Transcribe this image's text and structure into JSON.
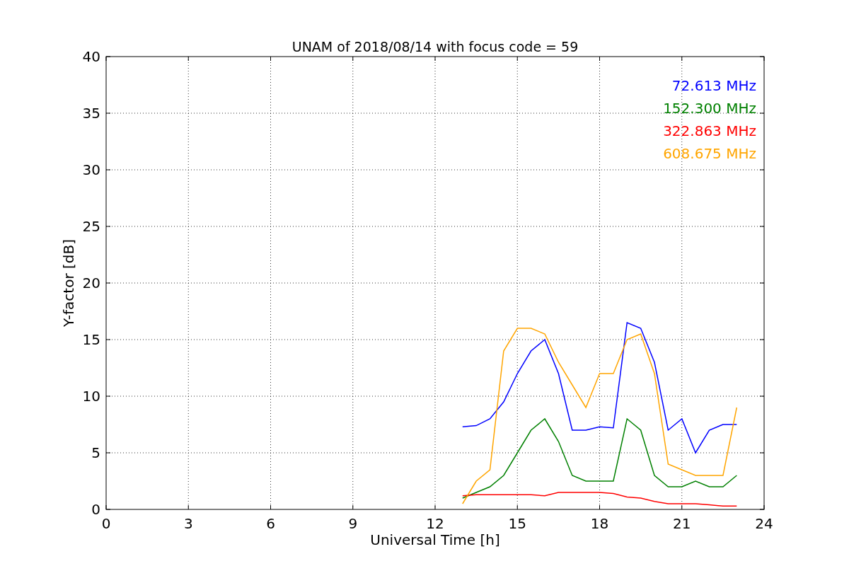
{
  "figure": {
    "chart_data": {
      "type": "line",
      "title": "UNAM of 2018/08/14 with focus code = 59",
      "xlabel": "Universal Time [h]",
      "ylabel": "Y-factor [dB]",
      "x": [
        13,
        13.5,
        14,
        14.5,
        15,
        15.5,
        16,
        16.5,
        17,
        17.5,
        18,
        18.5,
        19,
        19.5,
        20,
        20.5,
        21,
        21.5,
        22,
        22.5,
        23
      ],
      "series": [
        {
          "name": "72.613 MHz",
          "color": "#0000ff",
          "values": [
            7.3,
            7.4,
            8,
            9.5,
            12,
            14,
            15,
            12,
            7,
            7,
            7.3,
            7.2,
            16.5,
            16,
            13,
            7,
            8,
            5,
            7,
            7.5,
            7.5
          ]
        },
        {
          "name": "152.300 MHz",
          "color": "#008000",
          "values": [
            1,
            1.5,
            2,
            3,
            5,
            7,
            8,
            6,
            3,
            2.5,
            2.5,
            2.5,
            8,
            7,
            3,
            2,
            2,
            2.5,
            2,
            2,
            3
          ]
        },
        {
          "name": "322.863 MHz",
          "color": "#ff0000",
          "values": [
            1.2,
            1.3,
            1.3,
            1.3,
            1.3,
            1.3,
            1.2,
            1.5,
            1.5,
            1.5,
            1.5,
            1.4,
            1.1,
            1,
            0.7,
            0.5,
            0.5,
            0.5,
            0.4,
            0.3,
            0.3
          ]
        },
        {
          "name": "608.675 MHz",
          "color": "#ffa500",
          "values": [
            0.5,
            2.5,
            3.5,
            14,
            16,
            16,
            15.5,
            13,
            11,
            9,
            12,
            12,
            15,
            15.5,
            12,
            4,
            3.5,
            3,
            3,
            3,
            9
          ]
        }
      ],
      "xlim": [
        0,
        24
      ],
      "ylim": [
        0,
        40
      ],
      "xticks": [
        0,
        3,
        6,
        9,
        12,
        15,
        18,
        21,
        24
      ],
      "yticks": [
        0,
        5,
        10,
        15,
        20,
        25,
        30,
        35,
        40
      ],
      "grid": true
    }
  }
}
